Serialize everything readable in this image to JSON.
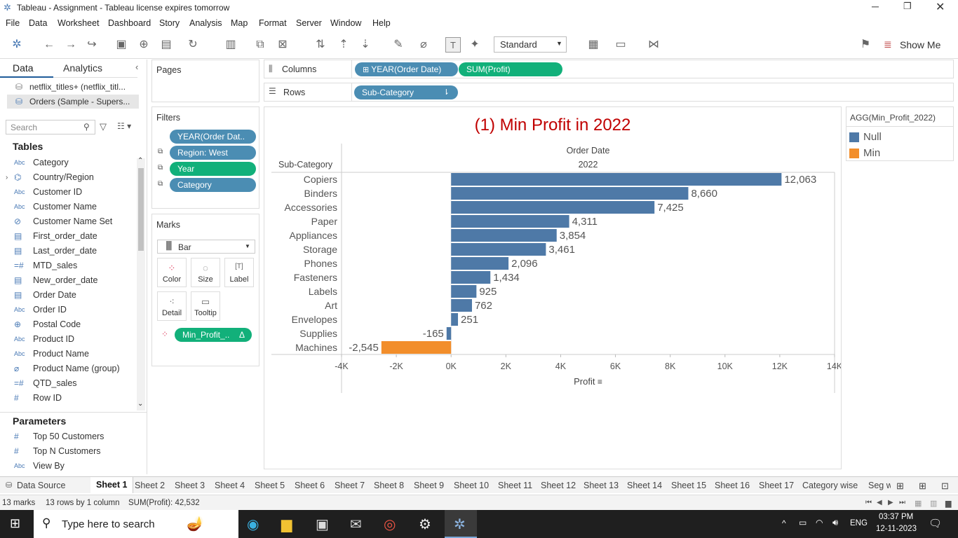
{
  "window": {
    "title": "Tableau - Assignment - Tableau license expires tomorrow"
  },
  "menu": [
    "File",
    "Data",
    "Worksheet",
    "Dashboard",
    "Story",
    "Analysis",
    "Map",
    "Format",
    "Server",
    "Window",
    "Help"
  ],
  "toolbar": {
    "fit_mode": "Standard",
    "show_me": "Show Me"
  },
  "left_pane": {
    "tabs": [
      "Data",
      "Analytics"
    ],
    "datasources": [
      "netflix_titles+ (netflix_titl...",
      "Orders (Sample - Supers..."
    ],
    "search_placeholder": "Search",
    "tables_header": "Tables",
    "fields": [
      {
        "icon": "Abc",
        "name": "Category"
      },
      {
        "icon": "geo",
        "name": "Country/Region"
      },
      {
        "icon": "Abc",
        "name": "Customer ID"
      },
      {
        "icon": "Abc",
        "name": "Customer Name"
      },
      {
        "icon": "set",
        "name": "Customer Name Set"
      },
      {
        "icon": "date",
        "name": "First_order_date"
      },
      {
        "icon": "date",
        "name": "Last_order_date"
      },
      {
        "icon": "calc",
        "name": "MTD_sales"
      },
      {
        "icon": "date",
        "name": "New_order_date"
      },
      {
        "icon": "date",
        "name": "Order Date"
      },
      {
        "icon": "Abc",
        "name": "Order ID"
      },
      {
        "icon": "globe",
        "name": "Postal Code"
      },
      {
        "icon": "Abc",
        "name": "Product ID"
      },
      {
        "icon": "Abc",
        "name": "Product Name"
      },
      {
        "icon": "group",
        "name": "Product Name (group)"
      },
      {
        "icon": "calc",
        "name": "QTD_sales"
      },
      {
        "icon": "#",
        "name": "Row ID"
      }
    ],
    "parameters_header": "Parameters",
    "parameters": [
      {
        "icon": "#",
        "name": "Top 50 Customers"
      },
      {
        "icon": "#",
        "name": "Top N Customers"
      },
      {
        "icon": "Abc",
        "name": "View By"
      }
    ]
  },
  "pages_label": "Pages",
  "filters": {
    "label": "Filters",
    "items": [
      "YEAR(Order Dat..",
      "Region: West",
      "Year",
      "Category"
    ]
  },
  "marks": {
    "label": "Marks",
    "type": "Bar",
    "buttons": [
      "Color",
      "Size",
      "Label",
      "Detail",
      "Tooltip"
    ],
    "color_pill": "Min_Profit_..",
    "color_pill_suffix": "Δ"
  },
  "columns": {
    "label": "Columns",
    "pills": [
      "YEAR(Order Date)",
      "SUM(Profit)"
    ]
  },
  "rows": {
    "label": "Rows",
    "pills": [
      "Sub-Category"
    ]
  },
  "legend": {
    "title": "AGG(Min_Profit_2022)",
    "items": [
      {
        "label": "Null",
        "color": "#4e79a7"
      },
      {
        "label": "Min",
        "color": "#f28e2b"
      }
    ]
  },
  "chart_data": {
    "type": "bar",
    "title": "(1) Min Profit in 2022",
    "column_header": "Order Date",
    "column_value": "2022",
    "row_header": "Sub-Category",
    "xlabel": "Profit",
    "xlim": [
      -4000,
      14000
    ],
    "xticks": [
      "-4K",
      "-2K",
      "0K",
      "2K",
      "4K",
      "6K",
      "8K",
      "10K",
      "12K",
      "14K"
    ],
    "categories": [
      "Copiers",
      "Binders",
      "Accessories",
      "Paper",
      "Appliances",
      "Storage",
      "Phones",
      "Fasteners",
      "Labels",
      "Art",
      "Envelopes",
      "Supplies",
      "Machines"
    ],
    "values": [
      12063,
      8660,
      7425,
      4311,
      3854,
      3461,
      2096,
      1434,
      925,
      762,
      251,
      -165,
      -2545
    ],
    "value_labels": [
      "12,063",
      "8,660",
      "7,425",
      "4,311",
      "3,854",
      "3,461",
      "2,096",
      "1,434",
      "925",
      "762",
      "251",
      "-165",
      "-2,545"
    ],
    "colors": [
      "#4e79a7",
      "#4e79a7",
      "#4e79a7",
      "#4e79a7",
      "#4e79a7",
      "#4e79a7",
      "#4e79a7",
      "#4e79a7",
      "#4e79a7",
      "#4e79a7",
      "#4e79a7",
      "#4e79a7",
      "#f28e2b"
    ],
    "title_color": "#c00000"
  },
  "sheet_tabs": [
    "Data Source",
    "Sheet 1",
    "Sheet 2",
    "Sheet 3",
    "Sheet 4",
    "Sheet 5",
    "Sheet 6",
    "Sheet 7",
    "Sheet 8",
    "Sheet 9",
    "Sheet 10",
    "Sheet 11",
    "Sheet 12",
    "Sheet 13",
    "Sheet 14",
    "Sheet 15",
    "Sheet 16",
    "Sheet 17",
    "Category wise",
    "Seg w"
  ],
  "status": {
    "marks": "13 marks",
    "rows": "13 rows by 1 column",
    "sum": "SUM(Profit): 42,532"
  },
  "taskbar": {
    "search_placeholder": "Type here to search",
    "lang": "ENG",
    "time": "03:37 PM",
    "date": "12-11-2023"
  }
}
